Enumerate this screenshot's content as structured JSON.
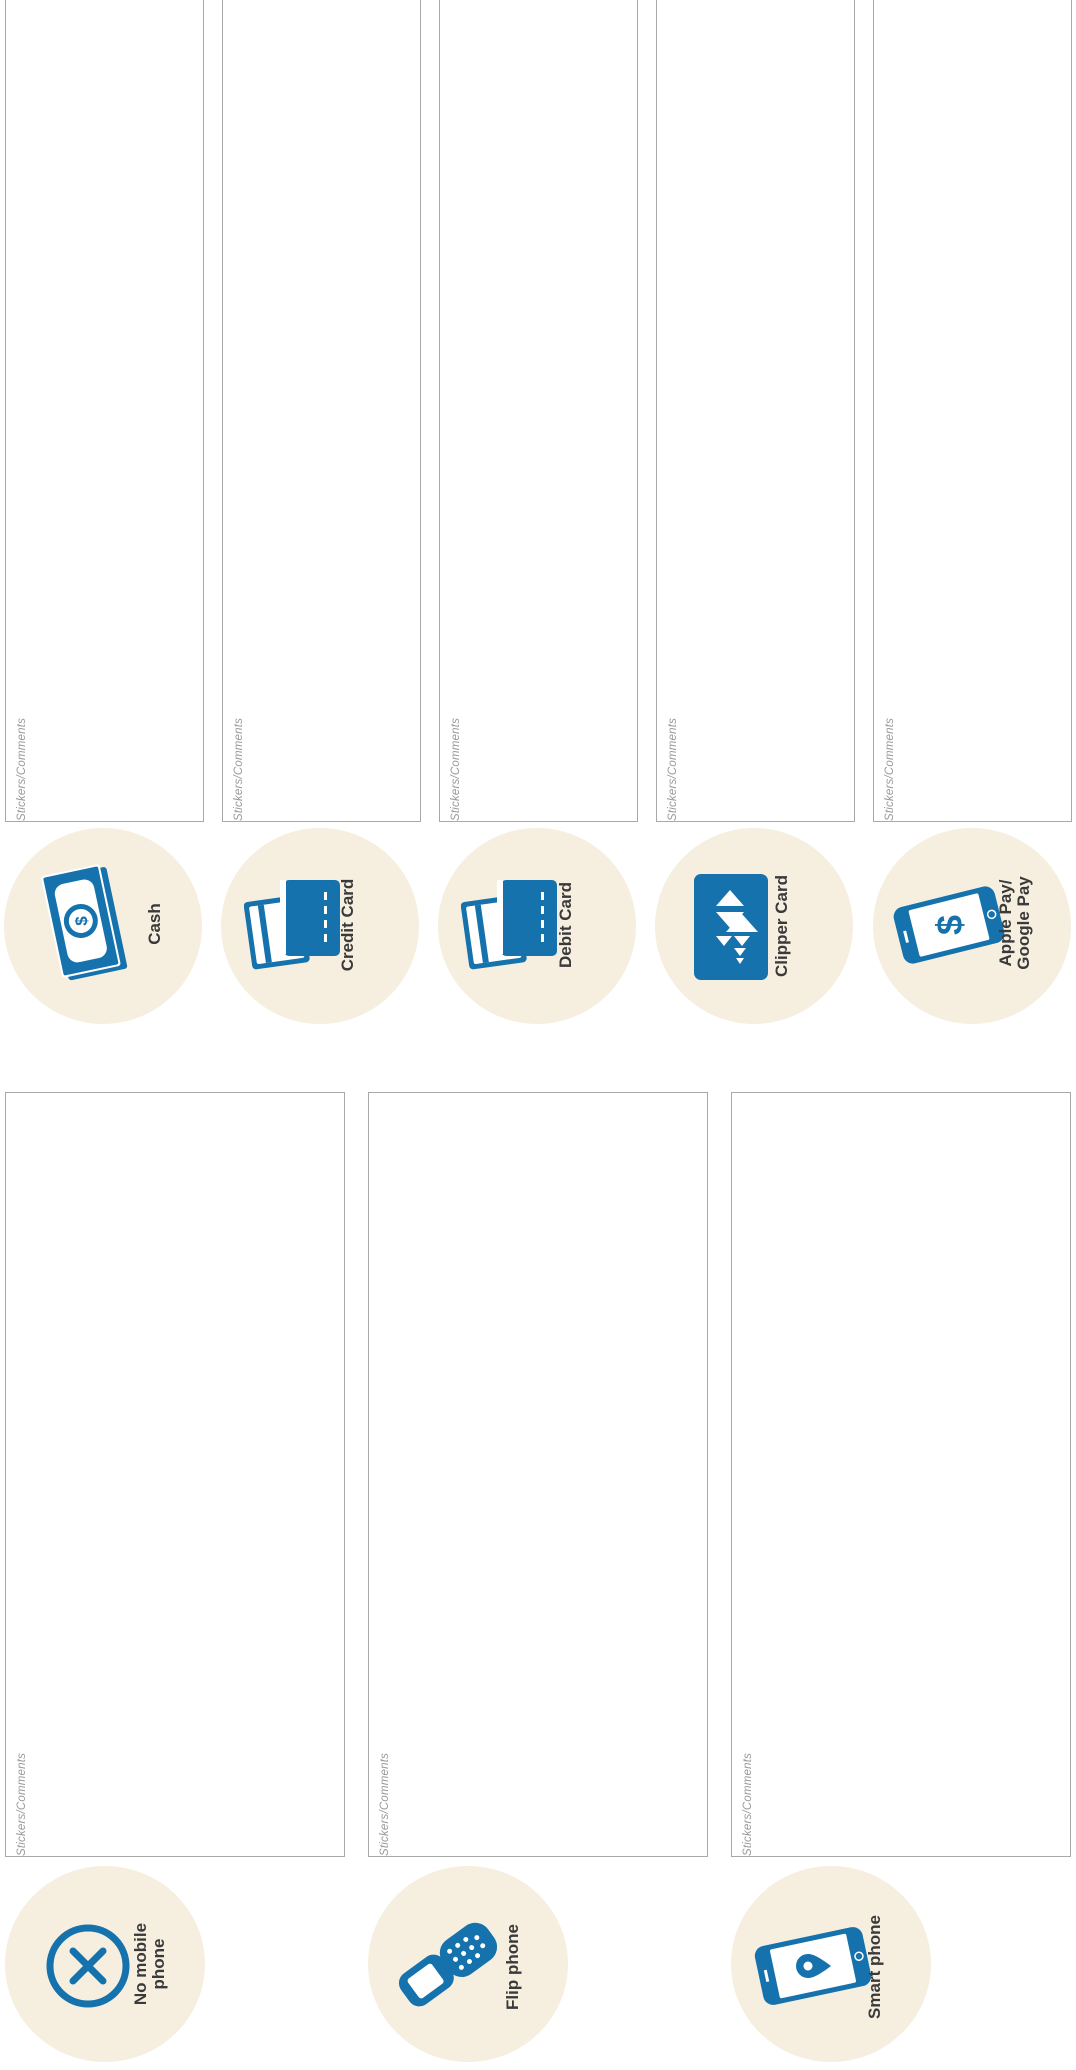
{
  "hint_text": "Stickers/Comments",
  "payment_options": [
    {
      "label": "Cash",
      "icon": "cash-icon"
    },
    {
      "label": "Credit Card",
      "icon": "credit-card-icon"
    },
    {
      "label": "Debit Card",
      "icon": "debit-card-icon"
    },
    {
      "label": "Clipper Card",
      "icon": "clipper-card-icon"
    },
    {
      "label_line1": "Apple Pay/",
      "label_line2": "Google Pay",
      "icon": "mobile-pay-icon"
    }
  ],
  "phone_options": [
    {
      "label_line1": "No mobile",
      "label_line2": "phone",
      "icon": "no-phone-icon"
    },
    {
      "label": "Flip phone",
      "icon": "flip-phone-icon"
    },
    {
      "label": "Smart phone",
      "icon": "smart-phone-icon"
    }
  ],
  "colors": {
    "icon_blue": "#1572ac",
    "circle_cream": "#f6efe0",
    "box_border": "#a9a9a9"
  }
}
